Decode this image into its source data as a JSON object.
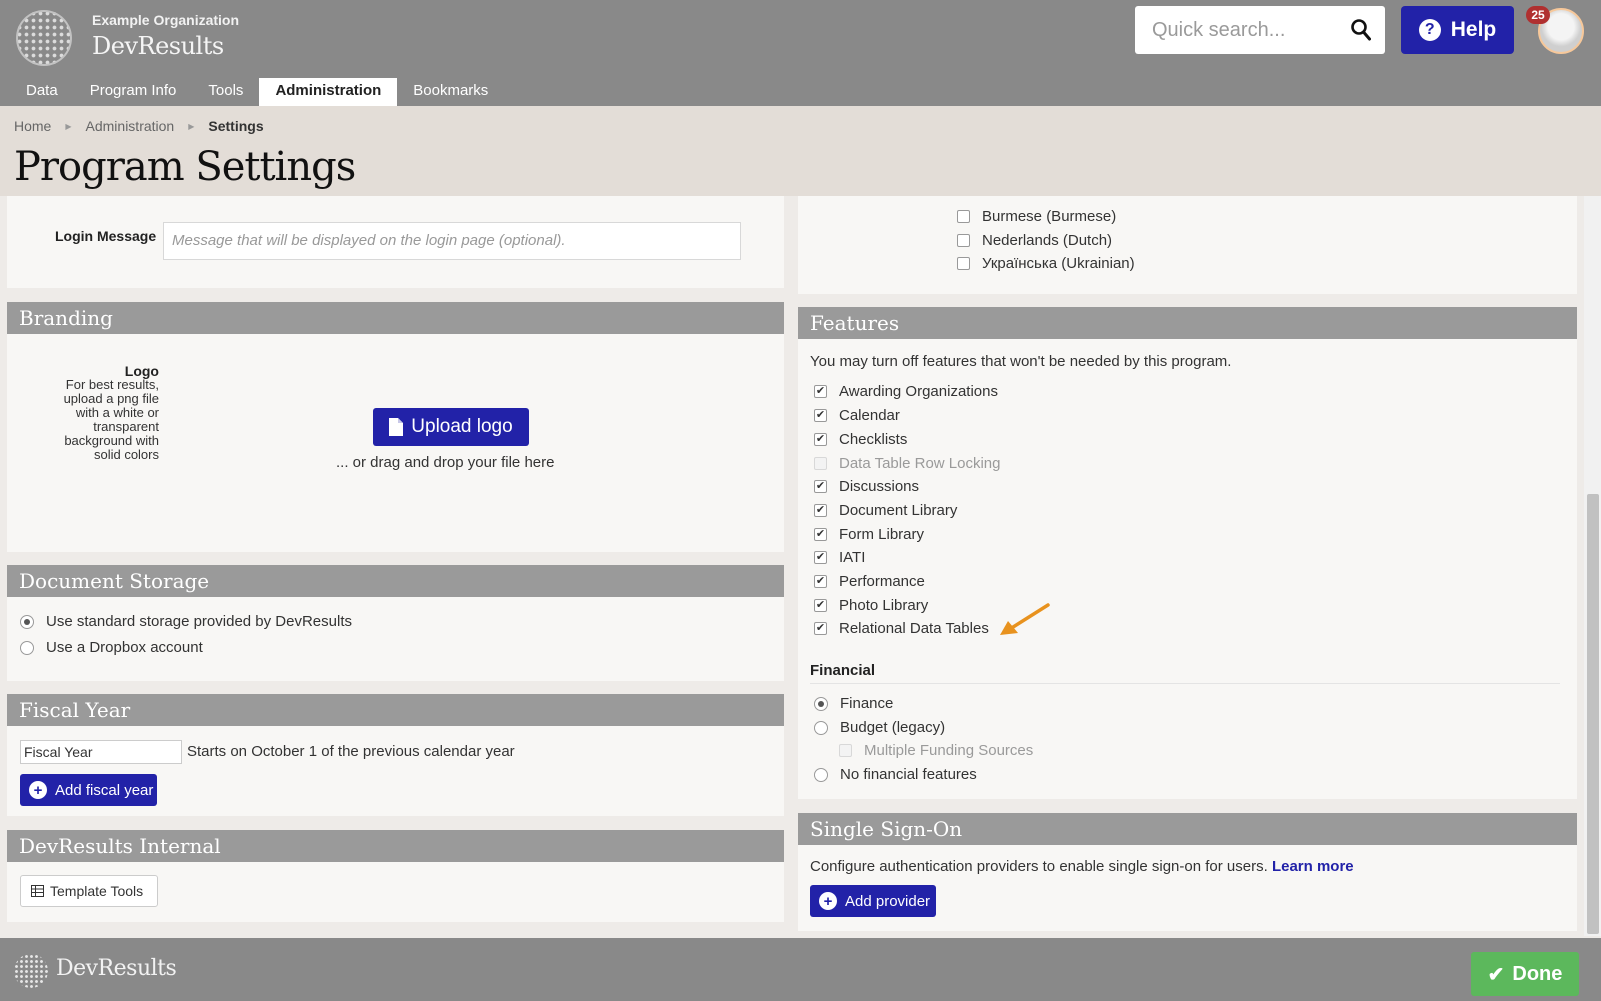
{
  "header": {
    "org_name": "Example Organization",
    "app_name": "DevResults",
    "search_placeholder": "Quick search...",
    "help_label": "Help",
    "notification_count": "25",
    "tabs": [
      "Data",
      "Program Info",
      "Tools",
      "Administration",
      "Bookmarks"
    ],
    "active_tab": "Administration"
  },
  "breadcrumb": [
    "Home",
    "Administration",
    "Settings"
  ],
  "page_title": "Program Settings",
  "left": {
    "login_message_label": "Login Message",
    "login_message_placeholder": "Message that will be displayed on the login page (optional).",
    "branding": {
      "title": "Branding",
      "logo_label": "Logo",
      "logo_help": "For best results, upload a png file with a white or transparent background with solid colors",
      "upload_label": "Upload logo",
      "drop_hint": "... or drag and drop your file here"
    },
    "document_storage": {
      "title": "Document Storage",
      "options": [
        {
          "label": "Use standard storage provided by DevResults",
          "selected": true
        },
        {
          "label": "Use a Dropbox account",
          "selected": false
        }
      ]
    },
    "fiscal_year": {
      "title": "Fiscal Year",
      "input_value": "Fiscal Year",
      "description": "Starts on October 1 of the previous calendar year",
      "add_label": "Add fiscal year"
    },
    "internal": {
      "title": "DevResults Internal",
      "template_tools_label": "Template Tools"
    }
  },
  "right": {
    "languages": [
      {
        "label": "Burmese (Burmese)",
        "checked": false
      },
      {
        "label": "Nederlands (Dutch)",
        "checked": false
      },
      {
        "label": "Українська (Ukrainian)",
        "checked": false
      }
    ],
    "features": {
      "title": "Features",
      "intro": "You may turn off features that won't be needed by this program.",
      "items": [
        {
          "label": "Awarding Organizations",
          "checked": true,
          "disabled": false
        },
        {
          "label": "Calendar",
          "checked": true,
          "disabled": false
        },
        {
          "label": "Checklists",
          "checked": true,
          "disabled": false
        },
        {
          "label": "Data Table Row Locking",
          "checked": false,
          "disabled": true
        },
        {
          "label": "Discussions",
          "checked": true,
          "disabled": false
        },
        {
          "label": "Document Library",
          "checked": true,
          "disabled": false
        },
        {
          "label": "Form Library",
          "checked": true,
          "disabled": false
        },
        {
          "label": "IATI",
          "checked": true,
          "disabled": false
        },
        {
          "label": "Performance",
          "checked": true,
          "disabled": false
        },
        {
          "label": "Photo Library",
          "checked": true,
          "disabled": false
        },
        {
          "label": "Relational Data Tables",
          "checked": true,
          "disabled": false
        }
      ],
      "financial_title": "Financial",
      "financial_options": [
        {
          "label": "Finance",
          "selected": true
        },
        {
          "label": "Budget (legacy)",
          "selected": false
        },
        {
          "label": "No financial features",
          "selected": false
        }
      ],
      "multiple_funding_label": "Multiple Funding Sources"
    },
    "sso": {
      "title": "Single Sign-On",
      "description": "Configure authentication providers to enable single sign-on for users.",
      "learn_more": "Learn more",
      "add_label": "Add provider"
    }
  },
  "footer": {
    "app_name": "DevResults",
    "done_label": "Done"
  },
  "colors": {
    "primary": "#2222a8",
    "header_bg": "#898989",
    "panel_head": "#9a9a9a",
    "success": "#5cb85c",
    "arrow": "#e8921e"
  }
}
